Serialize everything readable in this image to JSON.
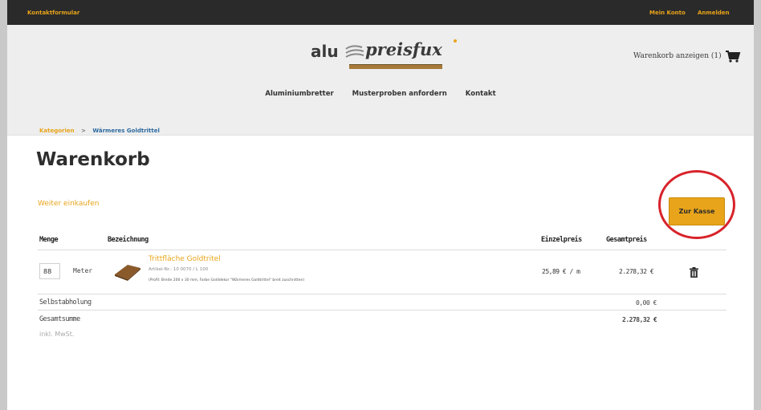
{
  "topbar": {
    "left_link": "Kontaktformular",
    "right_link_1": "Mein Konto",
    "right_link_2": "Anmelden"
  },
  "header": {
    "logo": {
      "part1": "alu",
      "part2": "preisfux"
    },
    "cart_label": "Warenkorb anzeigen (1)",
    "cart_icon": "cart-icon"
  },
  "nav": {
    "items": [
      "Aluminiumbretter",
      "Musterproben anfordern",
      "Kontakt"
    ]
  },
  "breadcrumb": {
    "item1": "Kategorien",
    "separator": ">",
    "item2": "Wärmeres Goldtrittel"
  },
  "page": {
    "title": "Warenkorb",
    "continue_link": "Weiter einkaufen",
    "checkout_button": "Zur Kasse",
    "highlight_color": "#d8232a",
    "accent_color": "#e8a41a"
  },
  "table": {
    "headers": {
      "qty": "Menge",
      "name": "Bezeichnung",
      "unit_price": "Einzelpreis",
      "total": "Gesamtpreis"
    },
    "row": {
      "qty": "88",
      "unit": "Meter",
      "product_name": "Trittfläche Goldtritel",
      "product_meta": "Artikel-Nr.: 10 0070 / L 100",
      "product_desc": "(Profil: Breite 200 x 30 mm, Farbe Golddekor \"Wärmeres Goldtrittel\" breit zuschnitten)",
      "unit_price": "25,89 € / m",
      "total_price": "2.278,32 €",
      "delete_icon": "trash-icon"
    },
    "summary": [
      {
        "label": "Selbstabholung",
        "value": "0,00 €"
      },
      {
        "label": "Gesamtsumme",
        "value": "2.278,32 €"
      }
    ],
    "tax_note": "inkl. MwSt."
  }
}
